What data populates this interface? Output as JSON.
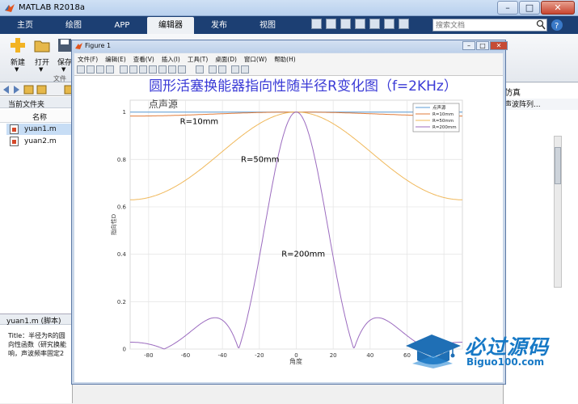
{
  "window": {
    "title": "MATLAB R2018a",
    "tabs": [
      "主页",
      "绘图",
      "APP",
      "编辑器",
      "发布",
      "视图"
    ],
    "active_tab": "编辑器",
    "search_placeholder": "搜索文档"
  },
  "toolstrip": {
    "new_label": "新建",
    "open_label": "打开",
    "save_label": "保存",
    "section_label": "文件"
  },
  "file_browser": {
    "header": "当前文件夹",
    "name_column": "名称",
    "files": [
      "yuan1.m",
      "yuan2.m"
    ],
    "selected_file": "yuan1.m"
  },
  "details": {
    "header": "yuan1.m  (脚本)",
    "text_lines": [
      "Title：半径为R的圆",
      "向性函数（研究换能",
      "响，声波频率固定2"
    ]
  },
  "right_panel": {
    "header": "仿真",
    "item": "声波阵列..."
  },
  "figure": {
    "window_title": "Figure 1",
    "menu": [
      "文件(F)",
      "编辑(E)",
      "查看(V)",
      "插入(I)",
      "工具(T)",
      "桌面(D)",
      "窗口(W)",
      "帮助(H)"
    ]
  },
  "chart_data": {
    "type": "line",
    "title": "圆形活塞换能器指向性随半径R变化图（f=2KHz）",
    "xlabel": "角度",
    "ylabel": "指向性D",
    "xlim": [
      -90,
      90
    ],
    "ylim": [
      0,
      1.05
    ],
    "xticks": [
      -80,
      -60,
      -40,
      -20,
      0,
      20,
      40,
      60,
      80
    ],
    "yticks": [
      0,
      0.2,
      0.4,
      0.6,
      0.8,
      1
    ],
    "grid": true,
    "legend_position": "top-right",
    "series": [
      {
        "name": "点声源",
        "color": "#5b9bd5",
        "r_mm": 0
      },
      {
        "name": "R=10mm",
        "color": "#e07b39",
        "r_mm": 10
      },
      {
        "name": "R=50mm",
        "color": "#f0b85a",
        "r_mm": 50
      },
      {
        "name": "R=200mm",
        "color": "#9b6bbf",
        "r_mm": 200
      }
    ],
    "annotations": [
      {
        "text": "点声源",
        "x": -80,
        "y": 1.02
      },
      {
        "text": "R=10mm",
        "x": -63,
        "y": 0.95
      },
      {
        "text": "R=50mm",
        "x": -30,
        "y": 0.79
      },
      {
        "text": "R=200mm",
        "x": -8,
        "y": 0.39
      }
    ]
  },
  "watermark": {
    "main": "必过源码",
    "sub": "Biguo100.com"
  }
}
